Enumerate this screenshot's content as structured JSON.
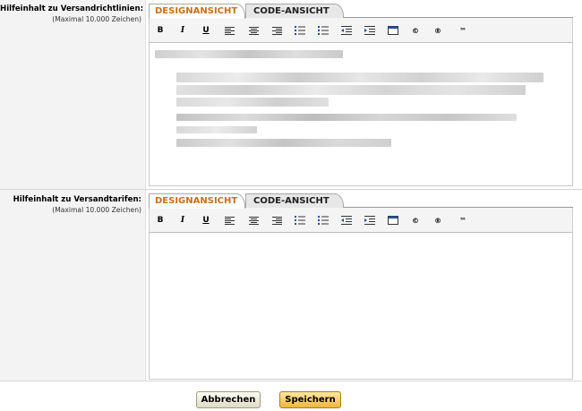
{
  "fields": [
    {
      "label": "Hilfeinhalt zu Versandrichtlinien:",
      "hint": "(Maximal 10.000 Zeichen)"
    },
    {
      "label": "Hilfeinhalt zu Versandtarifen:",
      "hint": "(Maximal 10.000 Zeichen)"
    }
  ],
  "editor": {
    "tab_design": "DESIGNANSICHT",
    "tab_code": "CODE-ANSICHT",
    "toolbar": {
      "bold": "B",
      "italic": "I",
      "underline": "U",
      "copyright": "©",
      "registered": "®",
      "trademark": "™"
    }
  },
  "icons": [
    "align-left-icon",
    "align-center-icon",
    "align-right-icon",
    "ordered-list-icon",
    "unordered-list-icon",
    "outdent-icon",
    "indent-icon",
    "source-window-icon"
  ],
  "buttons": {
    "cancel": "Abbrechen",
    "save": "Speichern"
  },
  "colors": {
    "active_tab_text": "#c8701a",
    "save_button": "#f3b63c",
    "label_background": "#f3f3f3"
  }
}
